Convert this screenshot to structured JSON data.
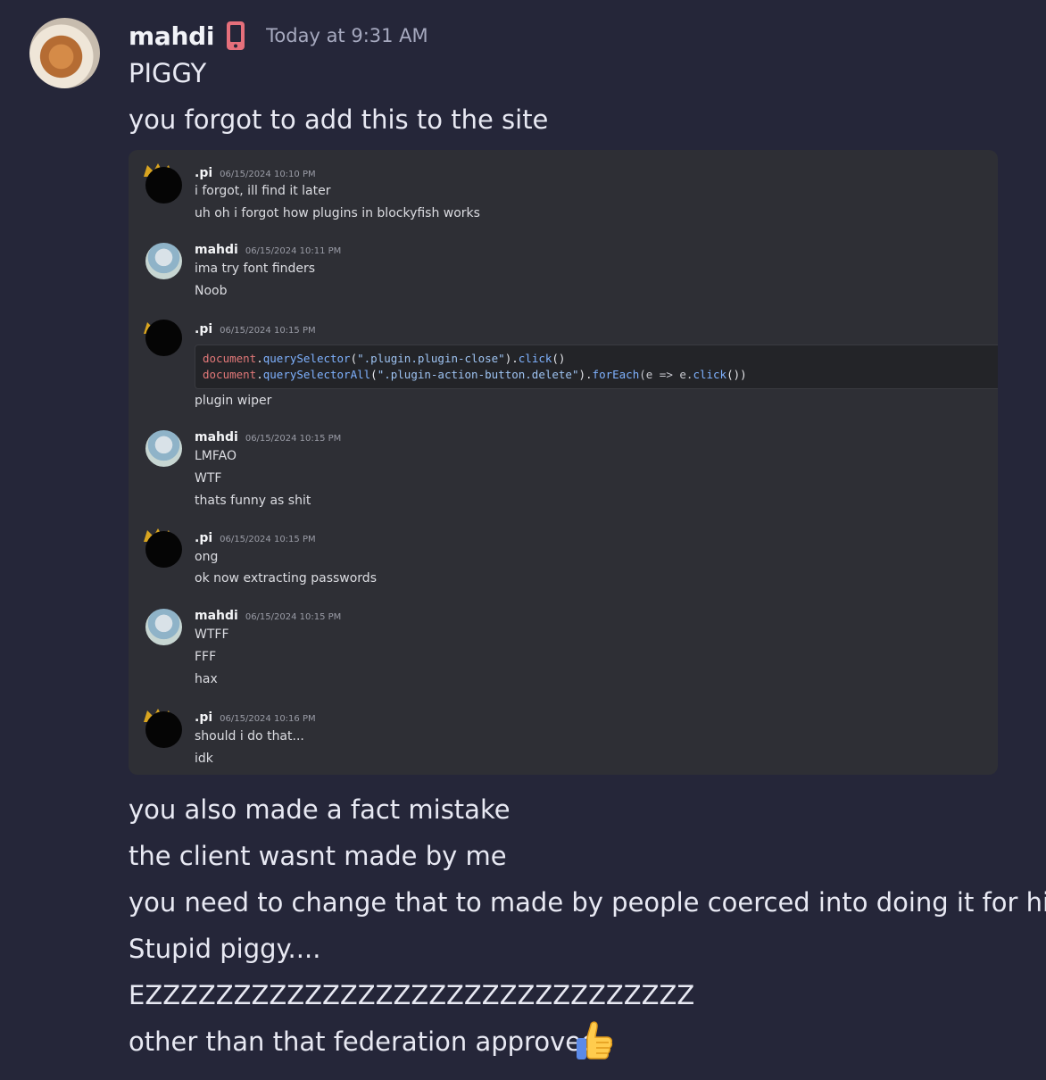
{
  "header": {
    "username": "mahdi",
    "timestamp": "Today at 9:31 AM",
    "badge_icon": "mobile-phone-icon",
    "badge_color": "#e56f7b"
  },
  "messages_top": [
    "PIGGY",
    "you forgot to add this to the site"
  ],
  "embed": {
    "msg1": {
      "author": ".pi",
      "time": "06/15/2024 10:10 PM",
      "lines": [
        "i forgot, ill find it later",
        "uh oh i forgot how plugins in blockyfish works"
      ]
    },
    "msg2": {
      "author": "mahdi",
      "time": "06/15/2024 10:11 PM",
      "lines": [
        "ima try font finders",
        "Noob"
      ]
    },
    "msg3": {
      "author": ".pi",
      "time": "06/15/2024 10:15 PM",
      "code": {
        "l1_obj": "document",
        "l1_dot": ".",
        "l1_fn": "querySelector",
        "l1_p1": "(",
        "l1_str": "\".plugin.plugin-close\"",
        "l1_p2": ").",
        "l1_fn2": "click",
        "l1_p3": "()",
        "l2_obj": "document",
        "l2_dot": ".",
        "l2_fn": "querySelectorAll",
        "l2_p1": "(",
        "l2_str": "\".plugin-action-button.delete\"",
        "l2_p2": ").",
        "l2_fn2": "forEach",
        "l2_p3": "(e => e.",
        "l2_fn3": "click",
        "l2_p4": "())"
      },
      "lines": [
        "plugin wiper"
      ]
    },
    "msg4": {
      "author": "mahdi",
      "time": "06/15/2024 10:15 PM",
      "lines": [
        "LMFAO",
        "WTF",
        "thats funny as shit"
      ]
    },
    "msg5": {
      "author": ".pi",
      "time": "06/15/2024 10:15 PM",
      "lines": [
        "ong",
        "ok now extracting passwords"
      ]
    },
    "msg6": {
      "author": "mahdi",
      "time": "06/15/2024 10:15 PM",
      "lines": [
        "WTFF",
        "FFF",
        "hax"
      ]
    },
    "msg7": {
      "author": ".pi",
      "time": "06/15/2024 10:16 PM",
      "lines": [
        "should i do that...",
        "idk"
      ]
    }
  },
  "messages_bottom": [
    "you also made a fact mistake",
    "the client wasnt made by me",
    "you need to change that to made by people coerced into doing it for him",
    "Stupid piggy....",
    "EZZZZZZZZZZZZZZZZZZZZZZZZZZZZZZZ",
    "other than that federation approved"
  ],
  "emoji": "thumbs-up-icon"
}
